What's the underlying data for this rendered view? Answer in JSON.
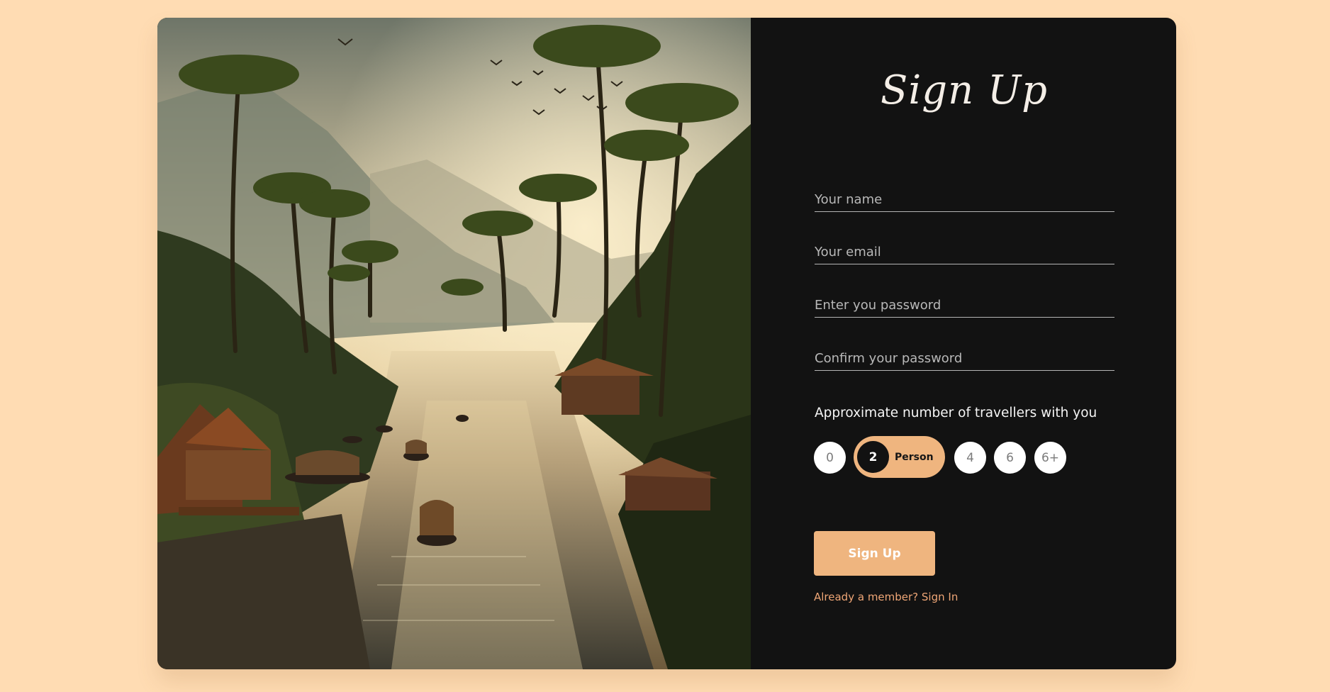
{
  "image": {
    "alt": "river-palm-houseboats-image"
  },
  "form": {
    "title": "Sign Up",
    "fields": [
      {
        "placeholder": "Your name",
        "value": ""
      },
      {
        "placeholder": "Your email",
        "value": ""
      },
      {
        "placeholder": "Enter you password",
        "value": ""
      },
      {
        "placeholder": "Confirm your password",
        "value": ""
      }
    ],
    "travellers": {
      "label": "Approximate number of travellers with you",
      "options": [
        "0",
        "2",
        "4",
        "6",
        "6+"
      ],
      "selected": "2",
      "selected_unit": "Person"
    },
    "submit_label": "Sign Up",
    "signin_text": "Already a member? Sign In"
  },
  "colors": {
    "page_background": "#ffdcb3",
    "panel_background": "#121212",
    "accent": "#efb57f",
    "link": "#efa676"
  }
}
